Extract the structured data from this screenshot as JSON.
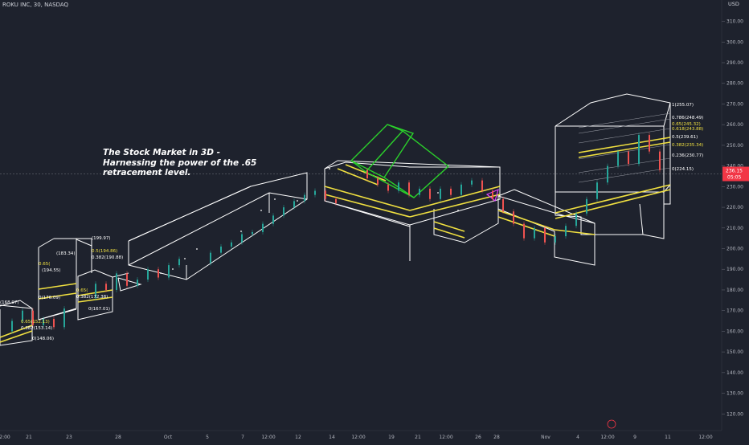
{
  "header": {
    "symbol_line": "ROKU INC, 30, NASDAQ",
    "currency": "USD"
  },
  "annotation": {
    "text": "The Stock Market in 3D - Harnessing the power of the .65 retracement level."
  },
  "chart_data": {
    "type": "line",
    "title": "",
    "y_axis": {
      "ticks": [
        120,
        130,
        140,
        150,
        160,
        170,
        180,
        190,
        200,
        210,
        220,
        230,
        240,
        250,
        260,
        270,
        280,
        290,
        300,
        310
      ],
      "tick_labels": [
        "120.00",
        "130.00",
        "140.00",
        "150.00",
        "160.00",
        "170.00",
        "180.00",
        "190.00",
        "200.00",
        "210.00",
        "220.00",
        "230.00",
        "240.00",
        "250.00",
        "260.00",
        "270.00",
        "280.00",
        "290.00",
        "300.00",
        "310.00"
      ],
      "range": [
        117,
        318
      ]
    },
    "x_axis": {
      "tick_labels": [
        "2:00",
        "21",
        "23",
        "28",
        "Oct",
        "5",
        "7",
        "12:00",
        "12",
        "14",
        "12:00",
        "19",
        "21",
        "12:00",
        "26",
        "28",
        "Nov",
        "4",
        "12:00",
        "9",
        "11",
        "12:00"
      ]
    },
    "current_price": {
      "value": 236.15,
      "label": "236.15",
      "sub_label": "05:05",
      "color": "#f23645"
    },
    "price_series": [
      {
        "t": 0,
        "p": 160
      },
      {
        "t": 1,
        "p": 165
      },
      {
        "t": 2,
        "p": 170
      },
      {
        "t": 3,
        "p": 163
      },
      {
        "t": 4,
        "p": 166
      },
      {
        "t": 5,
        "p": 162
      },
      {
        "t": 6,
        "p": 171
      },
      {
        "t": 8,
        "p": 176
      },
      {
        "t": 9,
        "p": 183
      },
      {
        "t": 10,
        "p": 180
      },
      {
        "t": 11,
        "p": 188
      },
      {
        "t": 12,
        "p": 182
      },
      {
        "t": 13,
        "p": 185
      },
      {
        "t": 14,
        "p": 190
      },
      {
        "t": 15,
        "p": 186
      },
      {
        "t": 16,
        "p": 192
      },
      {
        "t": 17,
        "p": 195
      },
      {
        "t": 19,
        "p": 193
      },
      {
        "t": 20,
        "p": 198
      },
      {
        "t": 21,
        "p": 201
      },
      {
        "t": 22,
        "p": 203
      },
      {
        "t": 23,
        "p": 207
      },
      {
        "t": 24,
        "p": 208
      },
      {
        "t": 25,
        "p": 212
      },
      {
        "t": 26,
        "p": 216
      },
      {
        "t": 27,
        "p": 220
      },
      {
        "t": 28,
        "p": 223
      },
      {
        "t": 29,
        "p": 226
      },
      {
        "t": 30,
        "p": 228
      },
      {
        "t": 31,
        "p": 224
      },
      {
        "t": 32,
        "p": 222
      },
      {
        "t": 34,
        "p": 238
      },
      {
        "t": 35,
        "p": 234
      },
      {
        "t": 36,
        "p": 231
      },
      {
        "t": 37,
        "p": 228
      },
      {
        "t": 38,
        "p": 232
      },
      {
        "t": 39,
        "p": 226
      },
      {
        "t": 40,
        "p": 229
      },
      {
        "t": 41,
        "p": 224
      },
      {
        "t": 42,
        "p": 229
      },
      {
        "t": 43,
        "p": 226
      },
      {
        "t": 44,
        "p": 231
      },
      {
        "t": 45,
        "p": 233
      },
      {
        "t": 46,
        "p": 228
      },
      {
        "t": 47,
        "p": 224
      },
      {
        "t": 48,
        "p": 218
      },
      {
        "t": 49,
        "p": 212
      },
      {
        "t": 50,
        "p": 205
      },
      {
        "t": 51,
        "p": 210
      },
      {
        "t": 52,
        "p": 203
      },
      {
        "t": 53,
        "p": 206
      },
      {
        "t": 54,
        "p": 211
      },
      {
        "t": 55,
        "p": 217
      },
      {
        "t": 56,
        "p": 224
      },
      {
        "t": 57,
        "p": 232
      },
      {
        "t": 58,
        "p": 240
      },
      {
        "t": 59,
        "p": 247
      },
      {
        "t": 60,
        "p": 241
      },
      {
        "t": 61,
        "p": 255
      },
      {
        "t": 62,
        "p": 247
      },
      {
        "t": 63,
        "p": 238
      }
    ],
    "fib_labels": [
      {
        "text": "(199.97)",
        "color": "#ffffff"
      },
      {
        "text": "0.5(194.86)",
        "color": "#f0e040"
      },
      {
        "text": "0.382(190.88)",
        "color": "#ffffff"
      },
      {
        "text": "(183.34)",
        "color": "#ffffff"
      },
      {
        "text": "0.65(",
        "color": "#f0e040"
      },
      {
        "text": "(194.55)",
        "color": "#ffffff"
      },
      {
        "text": "0(176.09)",
        "color": "#ffffff"
      },
      {
        "text": "0.65(",
        "color": "#f0e040"
      },
      {
        "text": "0.382(172.38)",
        "color": "#ffffff"
      },
      {
        "text": "0(167.01)",
        "color": "#ffffff"
      },
      {
        "text": "(168.97)",
        "color": "#ffffff"
      },
      {
        "text": "0.65(152.13)",
        "color": "#f0e040"
      },
      {
        "text": "0.382(153.14)",
        "color": "#ffffff"
      },
      {
        "text": "0(148.06)",
        "color": "#ffffff"
      },
      {
        "text": "1(255.07)",
        "color": "#ffffff"
      },
      {
        "text": "0.786(248.49)",
        "color": "#ffffff"
      },
      {
        "text": "0.65(245.32)",
        "color": "#f0e040"
      },
      {
        "text": "0.618(243.88)",
        "color": "#f0e040"
      },
      {
        "text": "0.5(239.61)",
        "color": "#ffffff"
      },
      {
        "text": "0.382(235.34)",
        "color": "#f0e040"
      },
      {
        "text": "0.236(230.77)",
        "color": "#ffffff"
      },
      {
        "text": "0(224.15)",
        "color": "#ffffff"
      }
    ],
    "colors": {
      "background": "#1e222d",
      "box_outline": "#ffffff",
      "fib_level": "#f0e040",
      "fib_line": "#9598a1",
      "green_box": "#2bd12b",
      "bull": "#26a69a",
      "bear": "#ef5350",
      "magenta": "#e040fb"
    }
  }
}
